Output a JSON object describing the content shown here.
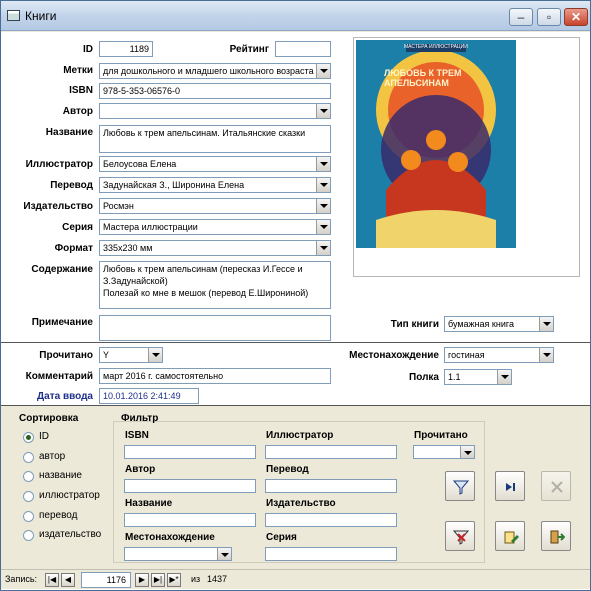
{
  "window": {
    "title": "Книги",
    "icon": "table-icon",
    "controls": [
      "minimize-icon",
      "maximize-icon",
      "close-icon"
    ]
  },
  "record": {
    "id_label": "ID",
    "id": "1189",
    "rating_label": "Рейтинг",
    "rating": "",
    "tags_label": "Метки",
    "tags": "для дошкольного и младшего школьного возраста",
    "isbn_label": "ISBN",
    "isbn": "978-5-353-06576-0",
    "author_label": "Автор",
    "author": "",
    "title_label": "Название",
    "title": "Любовь к трем апельсинам. Итальянские сказки",
    "illustrator_label": "Иллюстратор",
    "illustrator": "Белоусова Елена",
    "translation_label": "Перевод",
    "translation": "Задунайская З., Широнина Елена",
    "publisher_label": "Издательство",
    "publisher": "Росмэн",
    "series_label": "Серия",
    "series": "Мастера иллюстрации",
    "format_label": "Формат",
    "format": "335x230 мм",
    "contents_label": "Содержание",
    "contents": "Любовь к трем апельсинам (пересказ И.Гессе и З.Задунайской)\nПолезай ко мне в мешок (перевод Е.Широниной)",
    "note_label": "Примечание",
    "note": "",
    "book_type_label": "Тип книги",
    "book_type": "бумажная книга",
    "read_label": "Прочитано",
    "read": "Y",
    "location_label": "Местонахождение",
    "location": "гостиная",
    "comment_label": "Комментарий",
    "comment": "март 2016 г. самостоятельно",
    "shelf_label": "Полка",
    "shelf": "1.1",
    "entry_date_label": "Дата ввода",
    "entry_date": "10.01.2016 2:41:49",
    "cover_series": "МАСТЕРА ИЛЛЮСТРАЦИИ",
    "cover_title": "ЛЮБОВЬ К ТРЕМ АПЕЛЬСИНАМ"
  },
  "sort": {
    "title": "Сортировка",
    "options": [
      "ID",
      "автор",
      "название",
      "иллюстратор",
      "перевод",
      "издательство"
    ],
    "selected": 0
  },
  "filter": {
    "title": "Фильтр",
    "isbn": "ISBN",
    "illustrator": "Иллюстратор",
    "read": "Прочитано",
    "author": "Автор",
    "translation": "Перевод",
    "title_label": "Название",
    "publisher": "Издательство",
    "location": "Местонахождение",
    "series": "Серия"
  },
  "toolbar": {
    "buttons": [
      "filter-icon",
      "next-record-icon",
      "remove-filter-icon",
      "clear-filter-icon",
      "edit-icon",
      "exit-icon"
    ]
  },
  "navigation": {
    "label": "Запись:",
    "current": "1176",
    "of_label": "из",
    "total": "1437"
  },
  "colors": {
    "title_bar": "#c2d4ea",
    "form_bg": "#ffffff",
    "lower_bg": "#ece9d8",
    "accent_blue": "#1d2f8a",
    "close_button": "#c8432c"
  }
}
